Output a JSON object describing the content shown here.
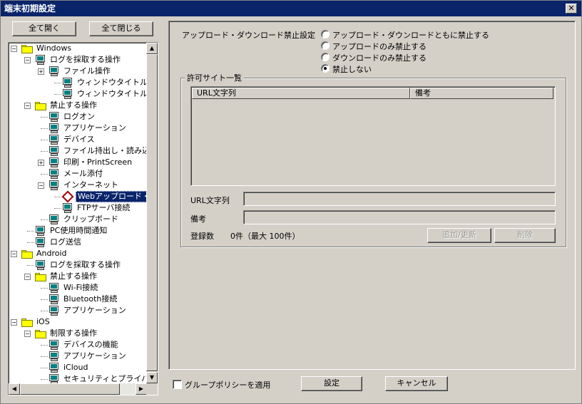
{
  "window": {
    "title": "端末初期設定",
    "close_label": "✕"
  },
  "toolbar": {
    "expand_all": "全て開く",
    "collapse_all": "全て閉じる"
  },
  "tree": [
    {
      "label": "Windows",
      "icon": "folder-icon",
      "expander": "−"
    },
    {
      "label": "ログを採取する操作",
      "icon": "computer-icon",
      "expander": "−"
    },
    {
      "label": "ファイル操作",
      "icon": "computer-icon",
      "expander": "+"
    },
    {
      "label": "ウィンドウタイトルフィル",
      "icon": "computer-icon"
    },
    {
      "label": "ウィンドウタイトル画面キ",
      "icon": "computer-icon"
    },
    {
      "label": "禁止する操作",
      "icon": "folder-icon",
      "expander": "−"
    },
    {
      "label": "ログオン",
      "icon": "computer-icon"
    },
    {
      "label": "アプリケーション",
      "icon": "computer-icon"
    },
    {
      "label": "デバイス",
      "icon": "computer-icon"
    },
    {
      "label": "ファイル持出し・読み込",
      "icon": "computer-icon"
    },
    {
      "label": "印刷・PrintScreen",
      "icon": "computer-icon",
      "expander": "+"
    },
    {
      "label": "メール添付",
      "icon": "computer-icon"
    },
    {
      "label": "インターネット",
      "icon": "computer-icon",
      "expander": "−"
    },
    {
      "label": "Webアップロード・ダ",
      "icon": "diamond-icon",
      "selected": true
    },
    {
      "label": "FTPサーバ接続",
      "icon": "computer-icon"
    },
    {
      "label": "クリップボード",
      "icon": "computer-icon"
    },
    {
      "label": "PC使用時間通知",
      "icon": "computer-icon"
    },
    {
      "label": "ログ送信",
      "icon": "computer-icon"
    },
    {
      "label": "Android",
      "icon": "folder-icon",
      "expander": "−"
    },
    {
      "label": "ログを採取する操作",
      "icon": "computer-icon"
    },
    {
      "label": "禁止する操作",
      "icon": "folder-icon",
      "expander": "−"
    },
    {
      "label": "Wi-Fi接続",
      "icon": "computer-icon"
    },
    {
      "label": "Bluetooth接続",
      "icon": "computer-icon"
    },
    {
      "label": "アプリケーション",
      "icon": "computer-icon"
    },
    {
      "label": "iOS",
      "icon": "folder-icon",
      "expander": "−"
    },
    {
      "label": "制限する操作",
      "icon": "folder-icon",
      "expander": "−"
    },
    {
      "label": "デバイスの機能",
      "icon": "computer-icon"
    },
    {
      "label": "アプリケーション",
      "icon": "computer-icon"
    },
    {
      "label": "iCloud",
      "icon": "computer-icon"
    },
    {
      "label": "セキュリティとプライバシ",
      "icon": "computer-icon"
    }
  ],
  "settings": {
    "label": "アップロード・ダウンロード禁止設定",
    "options": [
      {
        "label": "アップロード・ダウンロードともに禁止する",
        "checked": false
      },
      {
        "label": "アップロードのみ禁止する",
        "checked": false
      },
      {
        "label": "ダウンロードのみ禁止する",
        "checked": false
      },
      {
        "label": "禁止しない",
        "checked": true
      }
    ]
  },
  "allowed_sites": {
    "title": "許可サイト一覧",
    "columns": [
      "URL文字列",
      "備考"
    ],
    "rows": [],
    "url_label": "URL文字列",
    "url_value": "",
    "note_label": "備考",
    "note_value": "",
    "count_label": "登録数",
    "count_value": "0件（最大 100件）",
    "add_button": "追加/更新",
    "delete_button": "削除"
  },
  "footer": {
    "group_policy_label": "グループポリシーを適用",
    "group_policy_checked": false,
    "set_button": "設定",
    "cancel_button": "キャンセル"
  }
}
